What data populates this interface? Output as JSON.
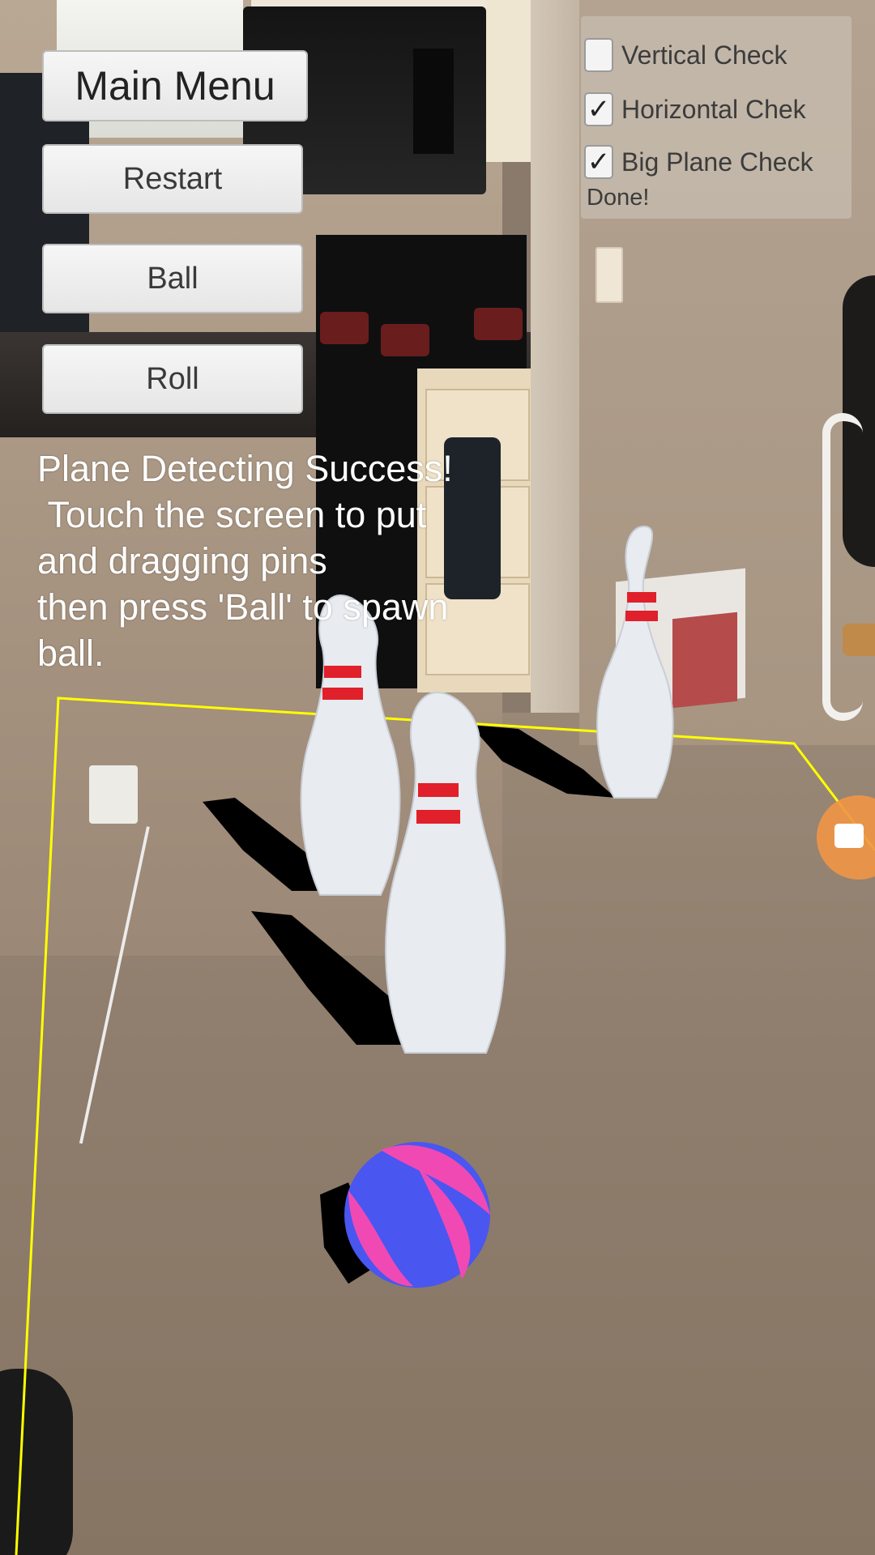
{
  "menu": {
    "main_menu_label": "Main Menu",
    "restart_label": "Restart",
    "ball_label": "Ball",
    "roll_label": "Roll"
  },
  "status": {
    "message": "Plane Detecting Success!\n Touch the screen to put\nand dragging pins\nthen press 'Ball' to spawn\nball."
  },
  "checks": {
    "vertical": {
      "label": "Vertical Check",
      "checked": false
    },
    "horizontal": {
      "label": "Horizontal Chek",
      "checked": true
    },
    "big_plane": {
      "label": "Big Plane Check",
      "checked": true
    },
    "done_text": "Done!"
  },
  "scene": {
    "plane_outline_color": "#ffff00",
    "ball_colors": [
      "#4a56f0",
      "#f049b4"
    ],
    "pin_stripe_color": "#e0202a"
  },
  "icons": {
    "record": "record-camera-icon",
    "checkmark": "checkmark-icon"
  }
}
